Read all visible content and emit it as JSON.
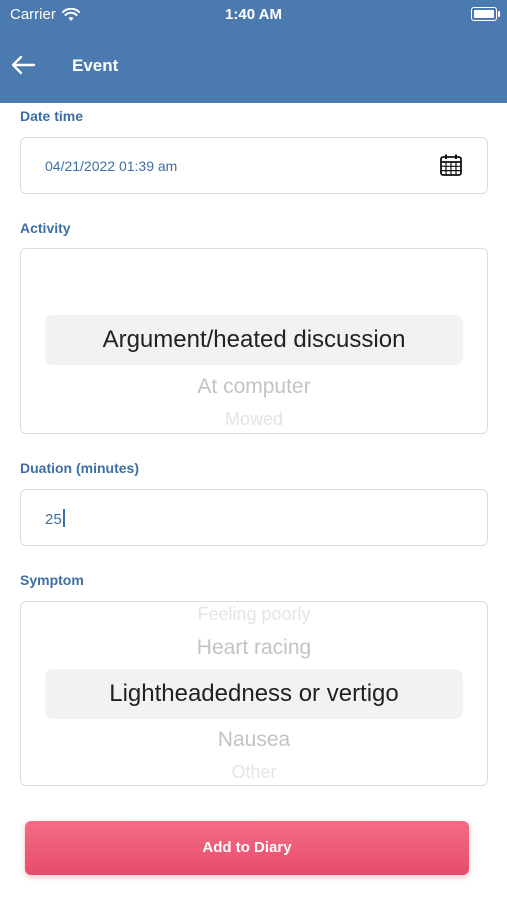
{
  "status": {
    "carrier": "Carrier",
    "time": "1:40 AM"
  },
  "nav": {
    "title": "Event"
  },
  "form": {
    "date_label": "Date time",
    "date_value": "04/21/2022 01:39 am",
    "activity_label": "Activity",
    "activity_options": [
      "Argument/heated discussion",
      "At computer",
      "Mowed"
    ],
    "activity_selected": "Argument/heated discussion",
    "duration_label": "Duation (minutes)",
    "duration_value": "25",
    "symptom_label": "Symptom",
    "symptom_options": [
      "Feeling poorly",
      "Heart racing",
      "Lightheadedness or vertigo",
      "Nausea",
      "Other"
    ],
    "symptom_selected": "Lightheadedness or vertigo"
  },
  "submit_label": "Add to Diary",
  "colors": {
    "header": "#4a7aaf",
    "accent": "#3d6fa3",
    "button": "#ee5a78"
  }
}
